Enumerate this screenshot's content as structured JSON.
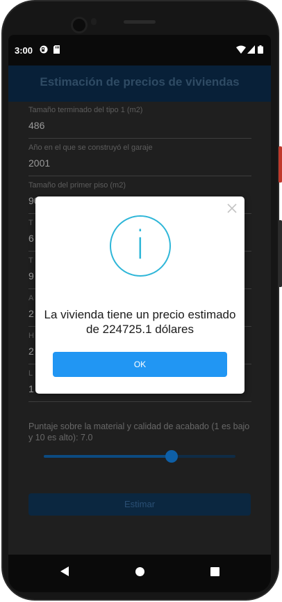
{
  "status_bar": {
    "time": "3:00"
  },
  "app": {
    "title": "Estimación de precios de viviendas"
  },
  "fields": [
    {
      "label": "Tamaño terminado del tipo 1 (m2)",
      "value": "486"
    },
    {
      "label": "Año en el que se construyó el garaje",
      "value": "2001"
    },
    {
      "label": "Tamaño del primer piso (m2)",
      "value": "90"
    },
    {
      "label": "T",
      "value": "6"
    },
    {
      "label": "T",
      "value": "9"
    },
    {
      "label": "A",
      "value": "2"
    },
    {
      "label": "H",
      "value": "2"
    },
    {
      "label": "L",
      "value": "1"
    }
  ],
  "quality_slider": {
    "label": "Puntaje sobre la material y calidad de acabado (1 es bajo y 10 es alto): 7.0",
    "value": 7.0,
    "min": 1,
    "max": 10
  },
  "estimate_button": "Estimar",
  "dialog": {
    "message": "La vivienda tiene un precio estimado de 224725.1 dólares",
    "ok_label": "OK",
    "icon": "info-icon"
  },
  "colors": {
    "accent": "#2196f3",
    "info": "#2eb6d8"
  }
}
